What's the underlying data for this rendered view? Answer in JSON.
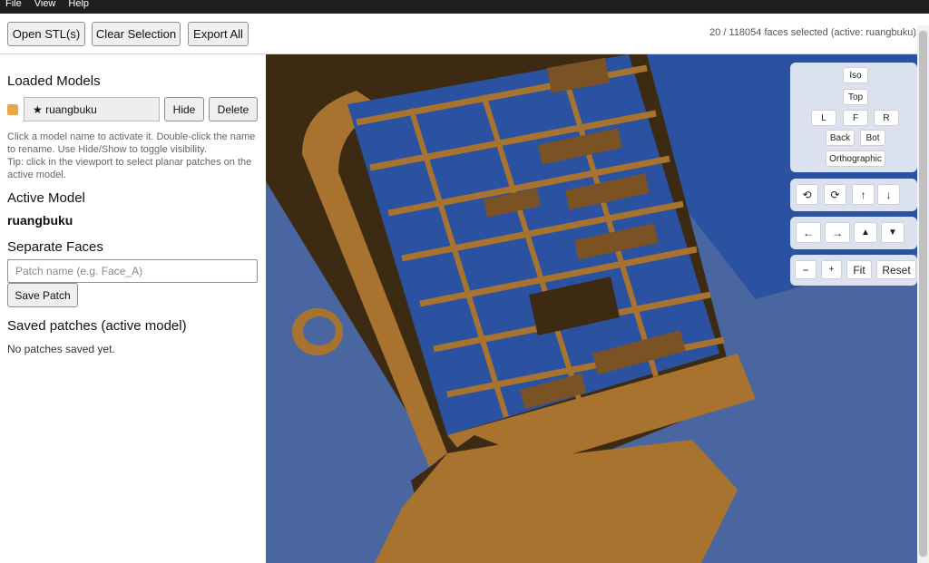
{
  "menu": [
    "File",
    "View",
    "Help"
  ],
  "toolbar": {
    "open_label": "Open STL(s)",
    "clear_label": "Clear Selection",
    "export_label": "Export All",
    "status": "20 / 118054 faces selected (active: ruangbuku)"
  },
  "sidebar": {
    "loaded_models_title": "Loaded Models",
    "model": {
      "name": "★ ruangbuku",
      "color": "#e8a84a",
      "hide_label": "Hide",
      "delete_label": "Delete"
    },
    "help_text_1": "Click a model name to activate it. Double-click the name to rename. Use Hide/Show to toggle visibility.",
    "help_text_2": "Tip: click in the viewport to select planar patches on the active model.",
    "active_model_title": "Active Model",
    "active_model_name": "ruangbuku",
    "separate_faces_title": "Separate Faces",
    "patch_placeholder": "Patch name (e.g. Face_A)",
    "save_patch_label": "Save Patch",
    "saved_patches_title": "Saved patches (active model)",
    "no_patches_text": "No patches saved yet."
  },
  "camera": {
    "iso": "Iso",
    "top": "Top",
    "left": "L",
    "front": "F",
    "right": "R",
    "back": "Back",
    "bottom": "Bot",
    "ortho": "Orthographic",
    "rot_ccw": "⟲",
    "rot_cw": "⟳",
    "up": "↑",
    "down": "↓",
    "pan_left": "←",
    "pan_right": "→",
    "tilt_up": "▲",
    "tilt_down": "▼",
    "zoom_out": "−",
    "zoom_in": "+",
    "fit": "Fit",
    "reset": "Reset"
  },
  "colors": {
    "model": "#a8732f",
    "model_dark": "#3d2a12",
    "window_blue": "#2b52a0",
    "floor_blue": "#4a66a0"
  }
}
